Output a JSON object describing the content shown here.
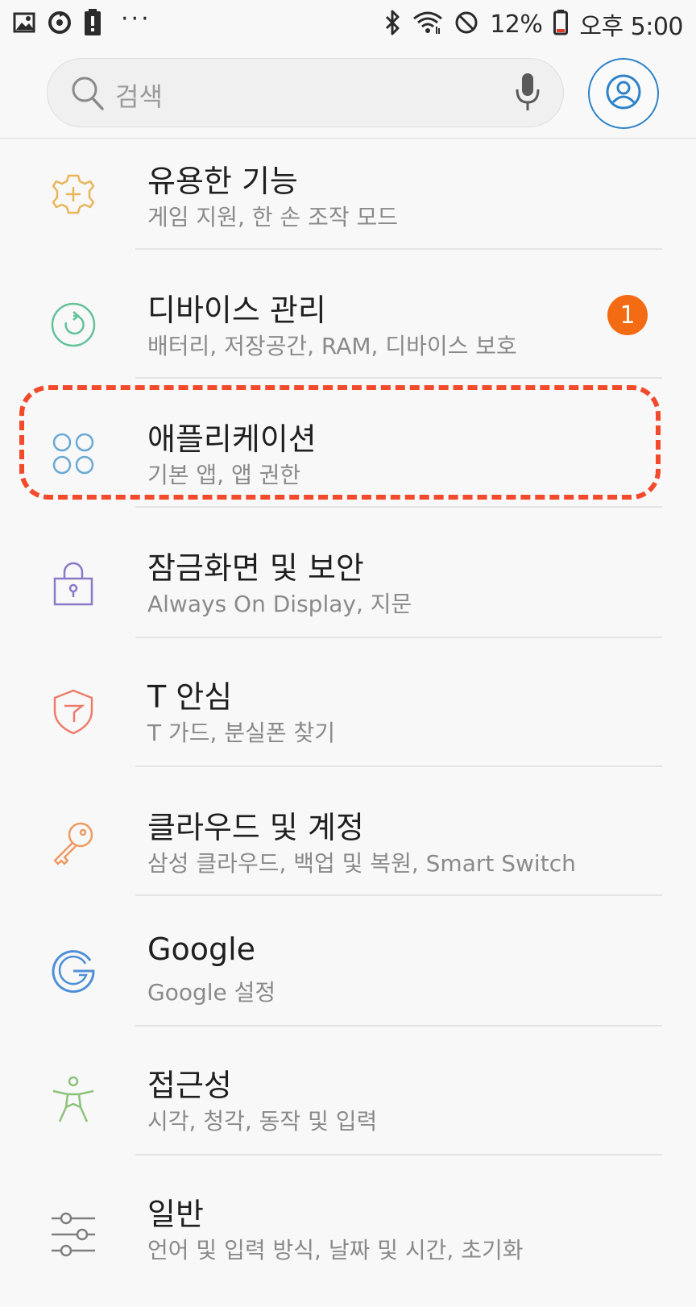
{
  "status_bar": {
    "left_icons": [
      "image-icon",
      "sync-icon",
      "alert-battery-icon"
    ],
    "more": "···",
    "right_icons": [
      "bluetooth-icon",
      "wifi-icon",
      "do-not-disturb-icon"
    ],
    "battery_percent": "12%",
    "time": "오후 5:00"
  },
  "search": {
    "placeholder": "검색"
  },
  "account": {
    "icon": "account-icon",
    "color": "#2e82c8"
  },
  "colors": {
    "badge": "#f36b12",
    "highlight": "#f24a2a"
  },
  "items": [
    {
      "title": "유용한 기능",
      "subtitle": "게임 지원, 한 손 조작 모드",
      "icon": "gear-plus-icon",
      "color": "#e8b65a"
    },
    {
      "title": "디바이스 관리",
      "subtitle": "배터리, 저장공간, RAM, 디바이스 보호",
      "icon": "device-care-icon",
      "color": "#63c29a",
      "badge": "1"
    },
    {
      "title": "애플리케이션",
      "subtitle": "기본 앱, 앱 권한",
      "icon": "apps-grid-icon",
      "color": "#6aa9d4"
    },
    {
      "title": "잠금화면 및 보안",
      "subtitle": "Always On Display, 지문",
      "icon": "lock-icon",
      "color": "#8c79c9"
    },
    {
      "title": "T 안심",
      "subtitle": "T 가드, 분실폰 찾기",
      "icon": "shield-icon",
      "color": "#ee7c6a"
    },
    {
      "title": "클라우드 및 계정",
      "subtitle": "삼성 클라우드, 백업 및 복원, Smart Switch",
      "icon": "key-icon",
      "color": "#ee9a62"
    },
    {
      "title": "Google",
      "subtitle": "Google 설정",
      "icon": "google-icon",
      "color": "#4f8fd6"
    },
    {
      "title": "접근성",
      "subtitle": "시각, 청각, 동작 및 입력",
      "icon": "accessibility-icon",
      "color": "#8cc27a"
    },
    {
      "title": "일반",
      "subtitle": "언어 및 입력 방식, 날짜 및 시간, 초기화",
      "icon": "sliders-icon",
      "color": "#7f7f7f"
    }
  ]
}
